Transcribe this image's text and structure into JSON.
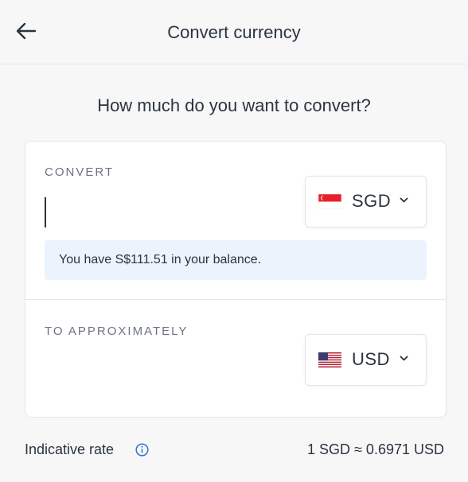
{
  "header": {
    "title": "Convert currency"
  },
  "question": "How much do you want to convert?",
  "convert": {
    "label": "CONVERT",
    "currency": "SGD",
    "balance_text": "You have S$111.51 in your balance."
  },
  "receive": {
    "label": "TO APPROXIMATELY",
    "currency": "USD"
  },
  "footer": {
    "rate_label": "Indicative rate",
    "rate_value": "1 SGD ≈ 0.6971 USD"
  },
  "colors": {
    "accent": "#2f6fd6",
    "balance_bg": "#ebf3fd",
    "text": "#2b3440"
  }
}
